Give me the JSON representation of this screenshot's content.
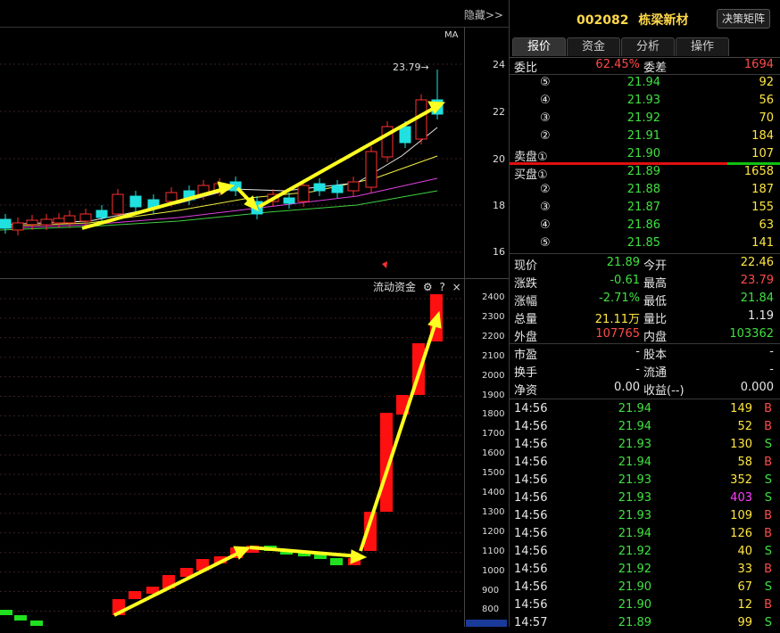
{
  "left_header": {
    "hide_label": "隐藏>>"
  },
  "kline": {
    "ma_label": "MA",
    "high_annotation": "23.79→",
    "price_axis": [
      "24",
      "22",
      "20",
      "18",
      "16"
    ]
  },
  "flow": {
    "panel_label": "流动资金",
    "help_label": "?",
    "close_label": "×",
    "value_axis": [
      "2400",
      "2300",
      "2200",
      "2100",
      "2000",
      "1900",
      "1800",
      "1700",
      "1600",
      "1500",
      "1400",
      "1300",
      "1200",
      "1100",
      "1000",
      "900",
      "800"
    ]
  },
  "quote": {
    "code": "002082",
    "name": "栋梁新材",
    "decision_button": "决策矩阵",
    "tabs": [
      "报价",
      "资金",
      "分析",
      "操作"
    ],
    "weibi_label": "委比",
    "weibi_value": "62.45%",
    "weicha_label": "委差",
    "weicha_value": "1694",
    "sell": [
      {
        "label": "⑤",
        "price": "21.94",
        "vol": "92"
      },
      {
        "label": "④",
        "price": "21.93",
        "vol": "56"
      },
      {
        "label": "③",
        "price": "21.92",
        "vol": "70"
      },
      {
        "label": "②",
        "price": "21.91",
        "vol": "184"
      },
      {
        "label": "卖盘①",
        "price": "21.90",
        "vol": "107"
      }
    ],
    "buy": [
      {
        "label": "买盘①",
        "price": "21.89",
        "vol": "1658"
      },
      {
        "label": "②",
        "price": "21.88",
        "vol": "187"
      },
      {
        "label": "③",
        "price": "21.87",
        "vol": "155"
      },
      {
        "label": "④",
        "price": "21.86",
        "vol": "63"
      },
      {
        "label": "⑤",
        "price": "21.85",
        "vol": "141"
      }
    ],
    "stats": [
      {
        "l1": "现价",
        "v1": "21.89",
        "l2": "今开",
        "v2": "22.46"
      },
      {
        "l1": "涨跌",
        "v1": "-0.61",
        "l2": "最高",
        "v2": "23.79"
      },
      {
        "l1": "涨幅",
        "v1": "-2.71%",
        "l2": "最低",
        "v2": "21.84"
      },
      {
        "l1": "总量",
        "v1": "21.11万",
        "l2": "量比",
        "v2": "1.19"
      },
      {
        "l1": "外盘",
        "v1": "107765",
        "l2": "内盘",
        "v2": "103362"
      },
      {
        "l1": "市盈",
        "v1": "-",
        "l2": "股本",
        "v2": "-"
      },
      {
        "l1": "换手",
        "v1": "-",
        "l2": "流通",
        "v2": "-"
      },
      {
        "l1": "净资",
        "v1": "0.00",
        "l2": "收益(--)",
        "v2": "0.000"
      }
    ],
    "ticks": [
      {
        "time": "14:56",
        "price": "21.94",
        "vol": "149",
        "side": "B"
      },
      {
        "time": "14:56",
        "price": "21.94",
        "vol": "52",
        "side": "B"
      },
      {
        "time": "14:56",
        "price": "21.93",
        "vol": "130",
        "side": "S"
      },
      {
        "time": "14:56",
        "price": "21.94",
        "vol": "58",
        "side": "B"
      },
      {
        "time": "14:56",
        "price": "21.93",
        "vol": "352",
        "side": "S"
      },
      {
        "time": "14:56",
        "price": "21.93",
        "vol": "403",
        "side": "S"
      },
      {
        "time": "14:56",
        "price": "21.93",
        "vol": "109",
        "side": "B"
      },
      {
        "time": "14:56",
        "price": "21.94",
        "vol": "126",
        "side": "B"
      },
      {
        "time": "14:56",
        "price": "21.92",
        "vol": "40",
        "side": "S"
      },
      {
        "time": "14:56",
        "price": "21.92",
        "vol": "33",
        "side": "B"
      },
      {
        "time": "14:56",
        "price": "21.90",
        "vol": "67",
        "side": "S"
      },
      {
        "time": "14:56",
        "price": "21.90",
        "vol": "12",
        "side": "B"
      },
      {
        "time": "14:57",
        "price": "21.89",
        "vol": "99",
        "side": "S"
      }
    ]
  }
}
